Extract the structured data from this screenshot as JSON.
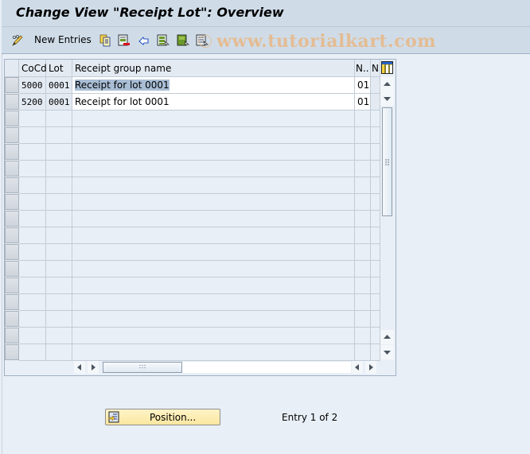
{
  "window": {
    "title": "Change View \"Receipt Lot\": Overview"
  },
  "toolbar": {
    "items": [
      {
        "name": "display-change-icon",
        "label": ""
      },
      {
        "name": "new-entries",
        "label": "New Entries"
      },
      {
        "name": "copy-icon",
        "label": ""
      },
      {
        "name": "delete-icon",
        "label": ""
      },
      {
        "name": "undo-icon",
        "label": ""
      },
      {
        "name": "select-all-icon",
        "label": ""
      },
      {
        "name": "select-block-icon",
        "label": ""
      },
      {
        "name": "deselect-all-icon",
        "label": ""
      }
    ],
    "watermark": "www.tutorialkart.com"
  },
  "table": {
    "columns": [
      "CoCd",
      "Lot",
      "Receipt group name",
      "N..",
      "N"
    ],
    "rows": [
      {
        "cocd": "5000",
        "lot": "0001",
        "name": "Receipt for lot 0001",
        "n": "01",
        "selected": true
      },
      {
        "cocd": "5200",
        "lot": "0001",
        "name": "Receipt for lot 0001",
        "n": "01",
        "selected": false
      }
    ],
    "empty_rows": 15
  },
  "footer": {
    "position_label": "Position...",
    "entry_text": "Entry 1 of 2"
  },
  "colors": {
    "title_bg": "#cfdce8",
    "body_bg": "#e9eff6",
    "selection": "#a9bed6",
    "button_bg": "#fbe7a0",
    "watermark": "#e7b98c"
  }
}
